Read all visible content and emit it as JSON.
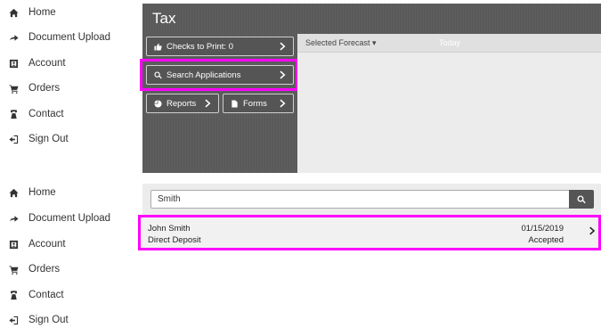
{
  "nav_top": [
    {
      "label": "Home",
      "icon": "home-icon"
    },
    {
      "label": "Document Upload",
      "icon": "arrow-right-icon"
    },
    {
      "label": "Account",
      "icon": "account-icon"
    },
    {
      "label": "Orders",
      "icon": "cart-icon"
    },
    {
      "label": "Contact",
      "icon": "phone-icon"
    },
    {
      "label": "Sign Out",
      "icon": "sign-out-icon"
    }
  ],
  "nav_bottom": [
    {
      "label": "Home",
      "icon": "home-icon"
    },
    {
      "label": "Document Upload",
      "icon": "arrow-right-icon"
    },
    {
      "label": "Account",
      "icon": "account-icon"
    },
    {
      "label": "Orders",
      "icon": "cart-icon"
    },
    {
      "label": "Contact",
      "icon": "phone-icon"
    },
    {
      "label": "Sign Out",
      "icon": "sign-out-icon"
    }
  ],
  "panel": {
    "title": "Tax",
    "checks_label": "Checks to Print: 0",
    "search_apps_label": "Search Applications",
    "reports_label": "Reports",
    "forms_label": "Forms"
  },
  "forecast": {
    "selected_label": "Selected Forecast ▾",
    "today_label": "Today"
  },
  "search": {
    "value": "Smith",
    "placeholder": ""
  },
  "result": {
    "name": "John Smith",
    "method": "Direct Deposit",
    "date": "01/15/2019",
    "status": "Accepted"
  },
  "colors": {
    "panel_bg": "#5a5a5a",
    "highlight": "#ff00ff",
    "forecast_bg": "#ececec"
  }
}
